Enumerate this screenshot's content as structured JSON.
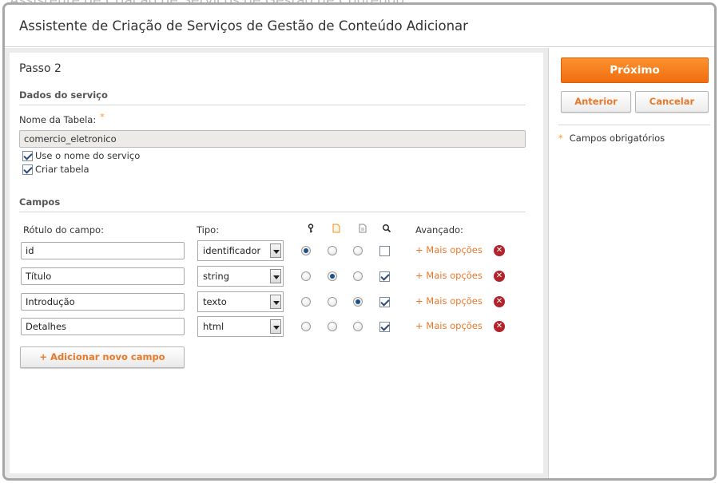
{
  "background_title": "Assistente de Criação de Serviços de Gestão de Conteúdo",
  "dialog": {
    "title": "Assistente de Criação de Serviços de Gestão de Conteúdo Adicionar"
  },
  "step": {
    "title": "Passo 2",
    "service_section": "Dados do serviço",
    "table_name_label": "Nome da Tabela:",
    "required_marker": "*",
    "table_name_value": "comercio_eletronico",
    "use_service_name_label": "Use o nome do serviço",
    "use_service_name_checked": true,
    "create_table_label": "Criar tabela",
    "create_table_checked": true
  },
  "fields": {
    "section_title": "Campos",
    "headers": {
      "label": "Rótulo do campo:",
      "type": "Tipo:",
      "advanced": "Avançado:"
    },
    "header_icons": [
      "key-icon",
      "title-icon",
      "summary-icon",
      "search-icon"
    ],
    "rows": [
      {
        "label": "id",
        "type": "identificador",
        "key": true,
        "title": false,
        "summary": false,
        "searchable": false,
        "more": "+ Mais opções"
      },
      {
        "label": "Título",
        "type": "string",
        "key": false,
        "title": true,
        "summary": false,
        "searchable": true,
        "more": "+ Mais opções"
      },
      {
        "label": "Introdução",
        "type": "texto",
        "key": false,
        "title": false,
        "summary": true,
        "searchable": true,
        "more": "+ Mais opções"
      },
      {
        "label": "Detalhes",
        "type": "html",
        "key": false,
        "title": false,
        "summary": false,
        "searchable": true,
        "more": "+ Mais opções"
      }
    ],
    "add_button": "+ Adicionar novo campo"
  },
  "sidebar": {
    "next_button": "Próximo",
    "previous_button": "Anterior",
    "cancel_button": "Cancelar",
    "required_star": "*",
    "required_note": "Campos obrigatórios"
  },
  "colors": {
    "accent_orange": "#f26d0e",
    "link_orange": "#e8792a",
    "delete_red": "#b3232a",
    "radio_selected": "#1f4e8c"
  }
}
